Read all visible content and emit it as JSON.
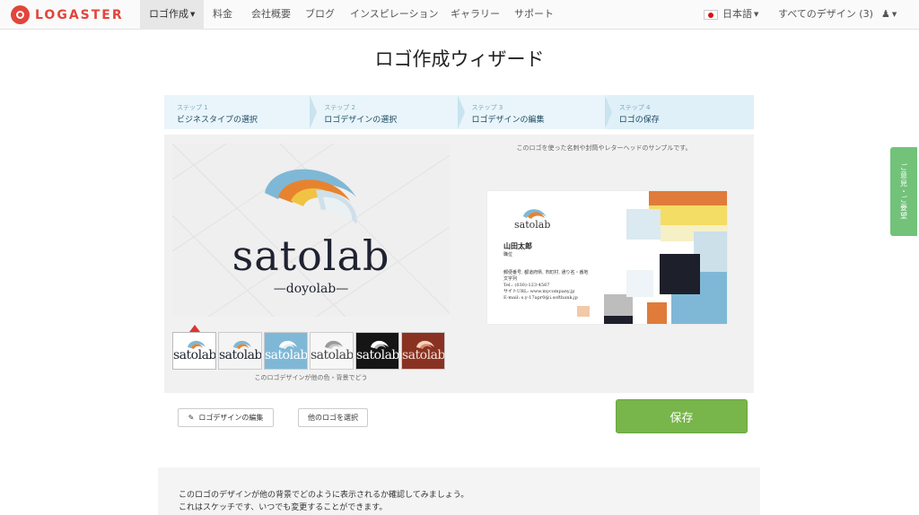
{
  "brand": {
    "name": "LOGASTER",
    "color": "#e2453c"
  },
  "nav": {
    "items": [
      "ロゴ作成",
      "料金",
      "会社概要",
      "ブログ",
      "インスピレーション",
      "ギャラリー",
      "サポート"
    ],
    "language": "日本語",
    "my_designs": "すべてのデザイン (3)"
  },
  "page": {
    "title": "ロゴ作成ウィザード"
  },
  "steps": [
    {
      "num": "ステップ 1",
      "label": "ビジネスタイプの選択"
    },
    {
      "num": "ステップ 2",
      "label": "ロゴデザインの選択"
    },
    {
      "num": "ステップ 3",
      "label": "ロゴデザインの編集"
    },
    {
      "num": "ステップ 4",
      "label": "ロゴの保存"
    }
  ],
  "logo": {
    "name": "satolab",
    "tagline": "—doyolab—"
  },
  "sample": {
    "caption": "このロゴを使った名刺や封筒やレターヘッドのサンプルです。",
    "card_name": "山田太郎",
    "card_role": "職位",
    "card_info": [
      "郵便番号, 都道府県, 市町村, 通り名・番地",
      "文字列",
      "Tel.: (030)-123-4567",
      "サイトURL: www.mycompany.jp",
      "E-mail: s.y-17apr0@i.softbank.jp"
    ]
  },
  "variants": {
    "labels": [
      "satolab",
      "satolab",
      "satolab",
      "satolab",
      "satolab",
      "satolab"
    ],
    "caption": "このロゴデザインが他の色・背景でどう"
  },
  "actions": {
    "edit": "ロゴデザインの編集",
    "choose_other": "他のロゴを選択",
    "save": "保存"
  },
  "info": {
    "line1": "このロゴのデザインが他の背景でどのように表示されるか確認してみましょう。",
    "line2": "これはスケッチです、いつでも変更することができます。"
  },
  "feedback": "ご意見・ご要望",
  "colors": {
    "accent_green": "#78b54a",
    "step_bg": "#dff0f8",
    "feedback_green": "#72c27a"
  }
}
